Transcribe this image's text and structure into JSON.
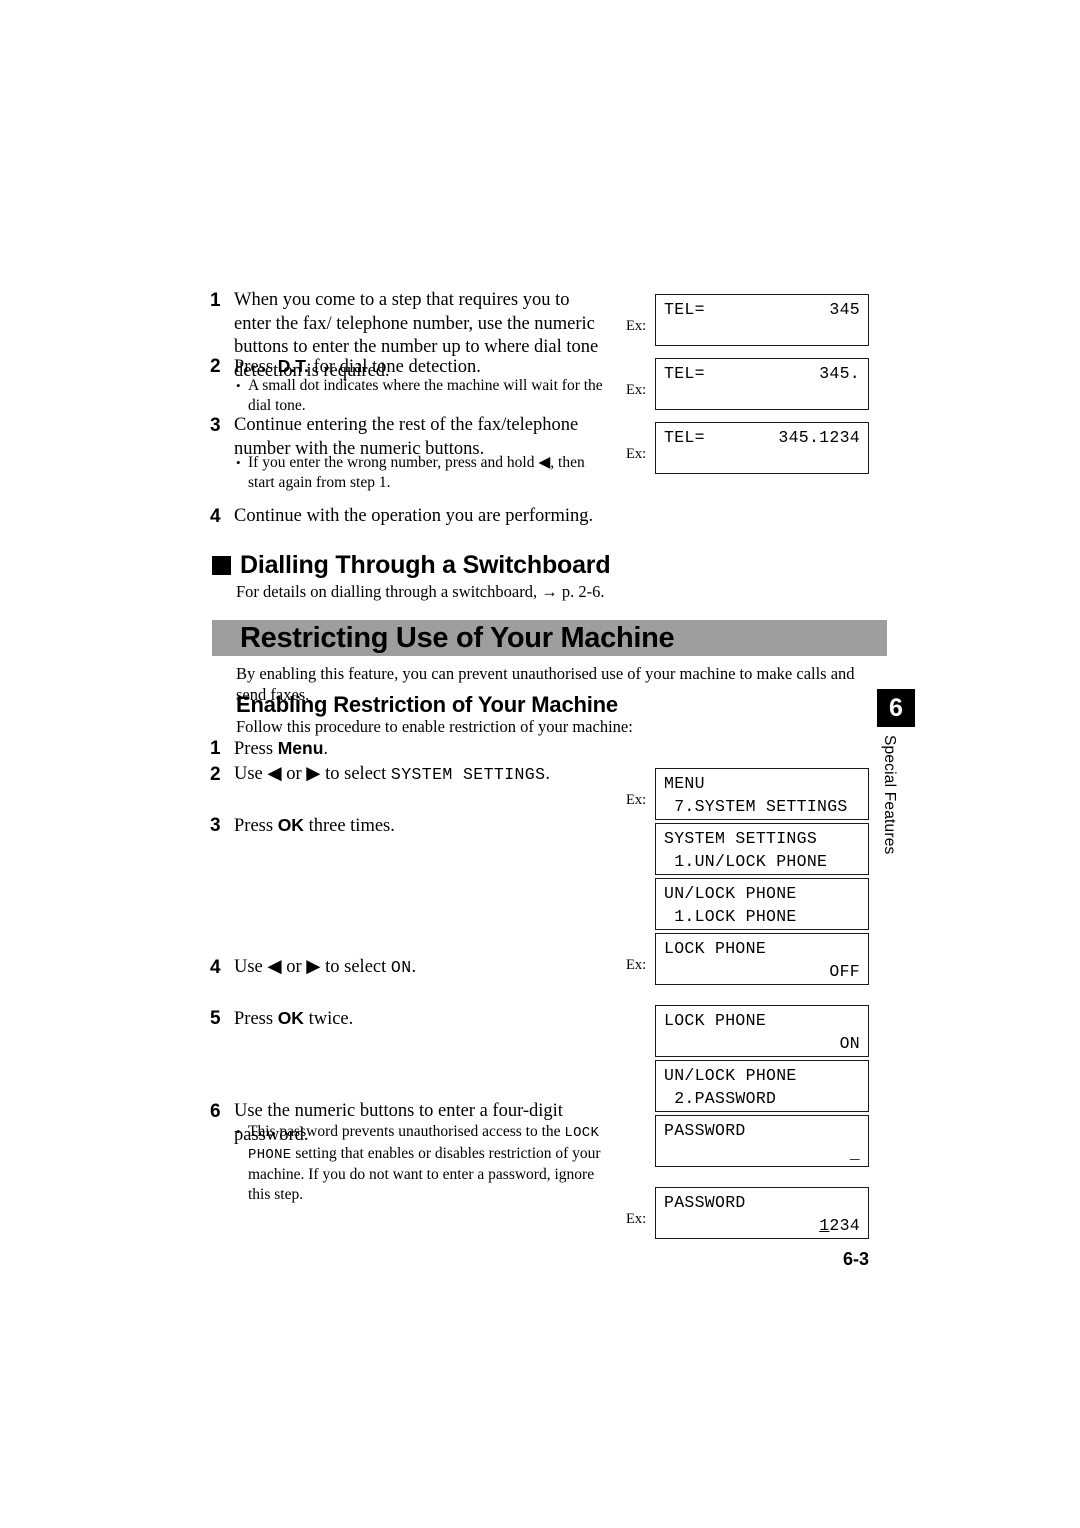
{
  "page": {
    "number": "6-3",
    "chapter_tab": "6",
    "chapter_label": "Special Features"
  },
  "top_procedure": {
    "steps": [
      {
        "num": "1",
        "text": "When you come to a step that requires you to enter the fax/ telephone number, use the numeric buttons to enter the number up to where dial tone detection is required."
      },
      {
        "num": "2",
        "text_before": "Press ",
        "bold": "D.T.",
        "text_after": " for dial tone detection.",
        "bullets": [
          "A small dot indicates where the machine will wait for the dial tone."
        ]
      },
      {
        "num": "3",
        "text": "Continue entering the rest of the fax/telephone number with the numeric buttons.",
        "bullets": [
          "If you enter the wrong number, press and hold ◀, then start again from step 1."
        ]
      },
      {
        "num": "4",
        "text": "Continue with the operation you are performing."
      }
    ],
    "displays": [
      {
        "ex": "Ex:",
        "line1_left": "TEL=",
        "line1_right": "345",
        "line2": ""
      },
      {
        "ex": "Ex:",
        "line1_left": "TEL=",
        "line1_right": "345.",
        "line2": ""
      },
      {
        "ex": "Ex:",
        "line1_left": "TEL=",
        "line1_right": "345.1234",
        "line2": ""
      }
    ]
  },
  "switchboard_section": {
    "heading": "Dialling Through a Switchboard",
    "body": "For details on dialling through a switchboard, → p. 2-6."
  },
  "restricting_section": {
    "banner_title": "Restricting Use of Your Machine",
    "intro": "By enabling this feature, you can prevent unauthorised use of your machine to make calls and send faxes.",
    "subheading": "Enabling Restriction of Your Machine",
    "subheading_body": "Follow this procedure to enable restriction of your machine:",
    "steps": [
      {
        "num": "1",
        "text_before": "Press ",
        "bold": "Menu",
        "text_after": "."
      },
      {
        "num": "2",
        "text_before": "Use ◀ or ▶ to select ",
        "lcd": "SYSTEM SETTINGS",
        "text_after": "."
      },
      {
        "num": "3",
        "text_before": "Press ",
        "bold": "OK",
        "text_after": " three times."
      },
      {
        "num": "4",
        "text_before": "Use ◀ or ▶ to select ",
        "lcd": "ON",
        "text_after": "."
      },
      {
        "num": "5",
        "text_before": "Press ",
        "bold": "OK",
        "text_after": " twice."
      },
      {
        "num": "6",
        "text": "Use the numeric buttons to enter a four-digit password.",
        "bullets": [
          {
            "parts": [
              {
                "t": "This password prevents unauthorised access to the ",
                "style": "serif"
              },
              {
                "t": "LOCK PHONE",
                "style": "mono"
              },
              {
                "t": " setting that enables or disables restriction of your machine. If you do not want to enter a password, ignore this step.",
                "style": "serif"
              }
            ]
          }
        ]
      }
    ],
    "displays": [
      {
        "ex": "Ex:",
        "line1": "MENU",
        "line2": " 7.SYSTEM SETTINGS",
        "align2": "left"
      },
      {
        "ex": "",
        "line1": "SYSTEM SETTINGS",
        "line2": " 1.UN/LOCK PHONE",
        "align2": "left"
      },
      {
        "ex": "",
        "line1": "UN/LOCK PHONE",
        "line2": " 1.LOCK PHONE",
        "align2": "left"
      },
      {
        "ex": "Ex:",
        "line1": "LOCK PHONE",
        "line2": "OFF",
        "align2": "right"
      },
      {
        "ex": "",
        "line1": "LOCK PHONE",
        "line2": "ON",
        "align2": "right"
      },
      {
        "ex": "",
        "line1": "UN/LOCK PHONE",
        "line2": " 2.PASSWORD",
        "align2": "left"
      },
      {
        "ex": "",
        "line1": "PASSWORD",
        "line2": "_",
        "align2": "right"
      },
      {
        "ex": "Ex:",
        "line1": "PASSWORD",
        "line2_underlined_first": "1",
        "line2_rest": "234",
        "align2": "right"
      }
    ]
  }
}
